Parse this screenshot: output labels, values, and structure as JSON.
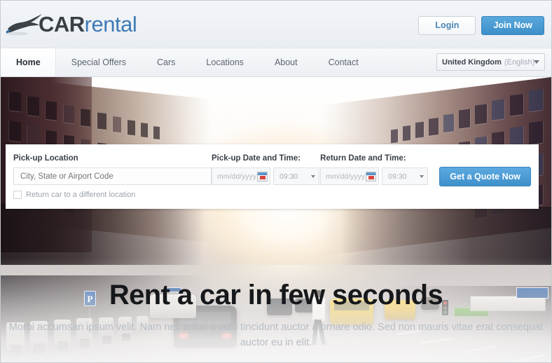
{
  "brand": {
    "logo_icon": "car-silhouette-icon",
    "name_bold": "CAR",
    "name_light": "rental"
  },
  "header": {
    "login_label": "Login",
    "join_label": "Join Now"
  },
  "nav": {
    "items": [
      {
        "label": "Home",
        "active": true
      },
      {
        "label": "Special Offers",
        "active": false
      },
      {
        "label": "Cars",
        "active": false
      },
      {
        "label": "Locations",
        "active": false
      },
      {
        "label": "About",
        "active": false
      },
      {
        "label": "Contact",
        "active": false
      }
    ],
    "country": {
      "name": "United Kingdom",
      "language": "(English)",
      "arrow_icon": "chevron-down-icon"
    }
  },
  "booking": {
    "pickup_location_label": "Pick-up Location",
    "pickup_location_placeholder": "City, State or Airport Code",
    "pickup_location_value": "",
    "return_different_label": "Return car to a different  location",
    "return_different_checked": false,
    "pickup_datetime_label": "Pick-up Date and Time:",
    "pickup_date_placeholder": "mm/dd/yyyy",
    "pickup_date_value": "",
    "pickup_time_value": "09:30",
    "return_datetime_label": "Return Date and Time:",
    "return_date_placeholder": "mm/dd/yyyy",
    "return_date_value": "",
    "return_time_value": "09:30",
    "calendar_icon": "calendar-icon",
    "time_arrow_icon": "chevron-down-icon",
    "quote_label": "Get a Quote Now"
  },
  "hero": {
    "title": "Rent a car in few seconds",
    "subtitle": "Morbi accumsan ipsum velit. Nam nec tellus a odio tincidunt auctor a ornare odio. Sed non  mauris vitae erat consequat auctor eu in elit.",
    "background_description": "sunlit city street with yellow taxis, pedestrian and parked scooters"
  },
  "street_signs": {
    "parking_1": "P",
    "parking_2": "P"
  },
  "colors": {
    "accent_blue": "#3f90ca",
    "accent_blue_light": "#5caae0",
    "logo_blue": "#3f7ab5",
    "logo_dark": "#3a3f45",
    "header_bg": "#eaeef3",
    "nav_bg": "#eceff3",
    "panel_bg": "#ffffff",
    "title_color": "#16181b",
    "subtitle_color": "#b9bec4",
    "taxi_yellow": "#e0b227"
  }
}
